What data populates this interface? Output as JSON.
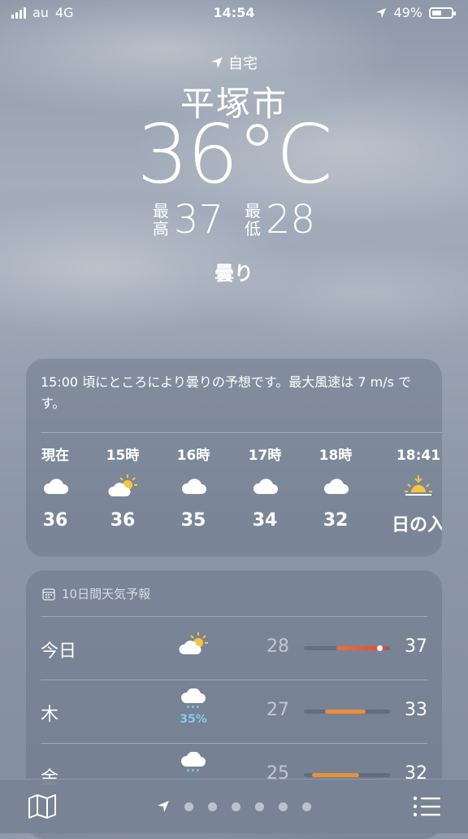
{
  "status_bar": {
    "carrier": "au",
    "network": "4G",
    "time": "14:54",
    "battery": "49%"
  },
  "location": {
    "label": "自宅",
    "city": "平塚市"
  },
  "current": {
    "temp": "36°C",
    "high_label_1": "最",
    "high_label_2": "高",
    "high": "37",
    "low_label_1": "最",
    "low_label_2": "低",
    "low": "28",
    "condition": "曇り"
  },
  "hourly_card": {
    "description": "15:00 頃にところにより曇りの予想です。最大風速は 7 m/s です。",
    "hours": [
      {
        "time": "現在",
        "icon": "cloud-icon",
        "value": "36"
      },
      {
        "time": "15時",
        "icon": "partly-sunny-icon",
        "value": "36"
      },
      {
        "time": "16時",
        "icon": "cloud-icon",
        "value": "35"
      },
      {
        "time": "17時",
        "icon": "cloud-icon",
        "value": "34"
      },
      {
        "time": "18時",
        "icon": "cloud-icon",
        "value": "32"
      },
      {
        "time": "18:41",
        "icon": "sunset-icon",
        "value": "日の入"
      }
    ]
  },
  "forecast_card": {
    "header": "10日間天気予報",
    "days": [
      {
        "day": "今日",
        "icon": "partly-sunny-icon",
        "precip": "",
        "low": "28",
        "high": "37"
      },
      {
        "day": "木",
        "icon": "rain-cloud-icon",
        "precip": "35%",
        "low": "27",
        "high": "33"
      },
      {
        "day": "金",
        "icon": "rain-cloud-icon",
        "precip": "",
        "low": "25",
        "high": "32"
      }
    ]
  },
  "colors": {
    "hot": "#f08a3c",
    "warm": "#e8903a",
    "red": "#e0573a"
  }
}
